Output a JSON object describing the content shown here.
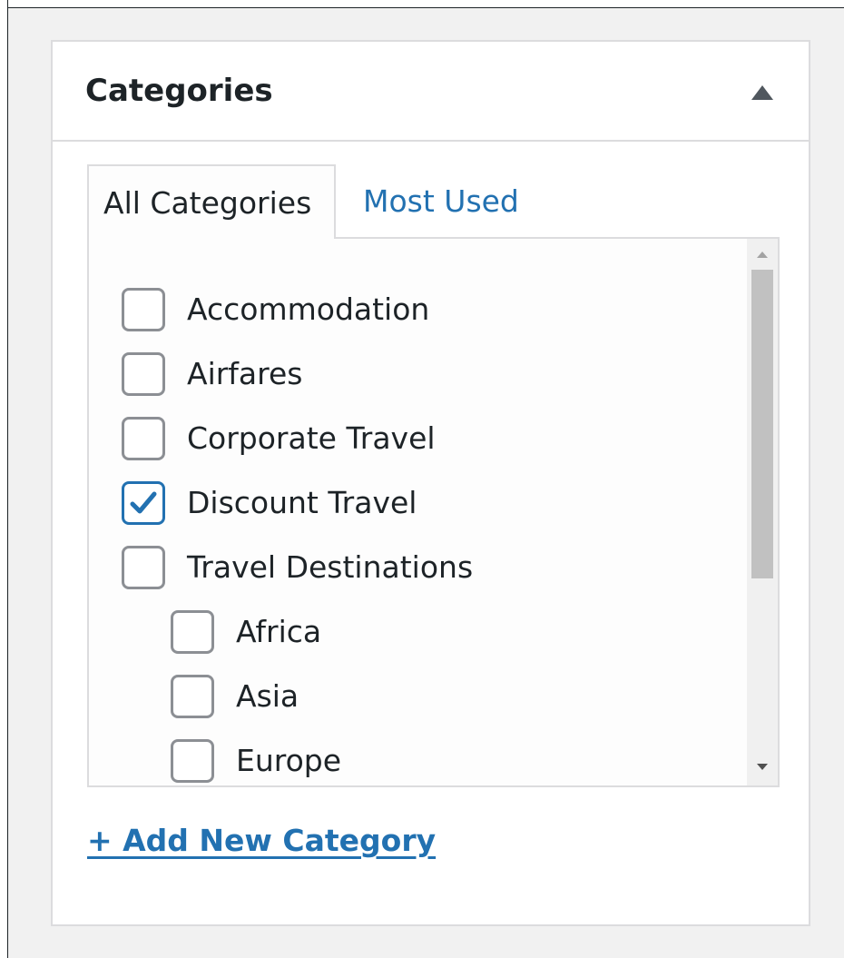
{
  "panel": {
    "title": "Categories",
    "toggle_icon": "triangle-up-icon"
  },
  "tabs": [
    {
      "label": "All Categories",
      "active": true
    },
    {
      "label": "Most Used",
      "active": false
    }
  ],
  "categories": [
    {
      "label": "Accommodation",
      "checked": false,
      "level": 0
    },
    {
      "label": "Airfares",
      "checked": false,
      "level": 0
    },
    {
      "label": "Corporate Travel",
      "checked": false,
      "level": 0
    },
    {
      "label": "Discount Travel",
      "checked": true,
      "level": 0
    },
    {
      "label": "Travel Destinations",
      "checked": false,
      "level": 0
    },
    {
      "label": "Africa",
      "checked": false,
      "level": 1
    },
    {
      "label": "Asia",
      "checked": false,
      "level": 1
    },
    {
      "label": "Europe",
      "checked": false,
      "level": 1
    }
  ],
  "add_new_label": "+ Add New Category",
  "colors": {
    "accent": "#2271b1",
    "text": "#1d2327",
    "border": "#dcdcde",
    "checkbox_border": "#8c8f94"
  }
}
